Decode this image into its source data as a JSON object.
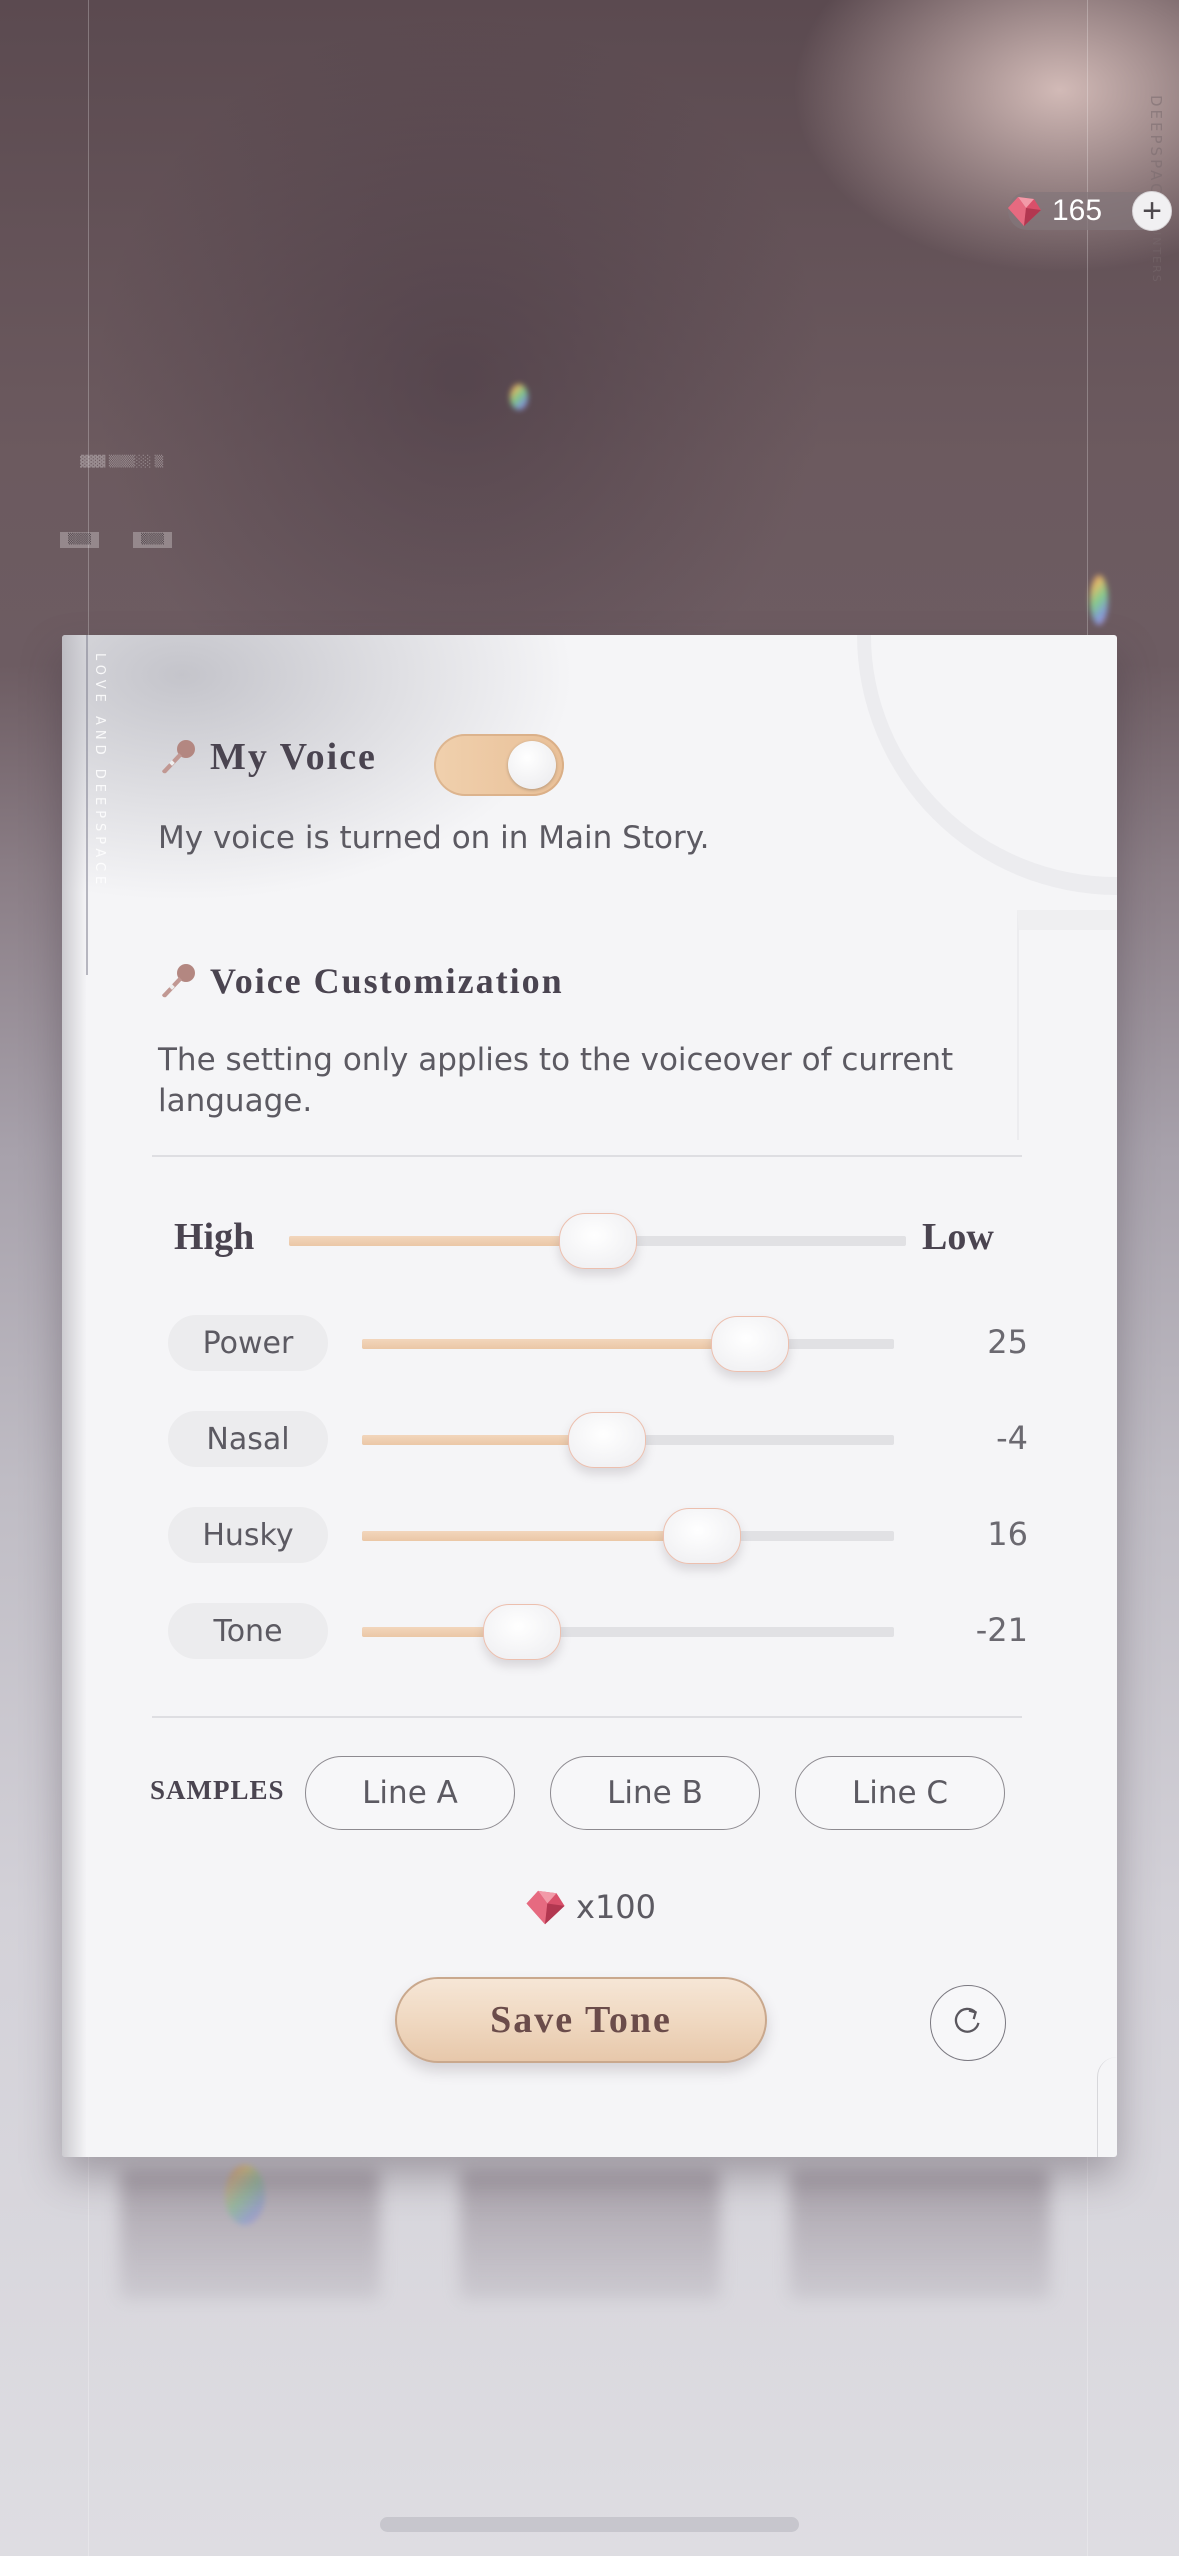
{
  "background": {
    "brand_vertical": "DEEPSPACE",
    "brand_vertical_sub": "HUNTERS"
  },
  "currency": {
    "icon": "gem-icon",
    "amount": "165",
    "add_icon": "plus-icon"
  },
  "panel": {
    "side_text": "LOVE AND DEEPSPACE",
    "my_voice": {
      "title": "My Voice",
      "icon": "microphone-icon",
      "toggle_on": true,
      "description": "My voice is turned on in Main Story."
    },
    "customization": {
      "title": "Voice Customization",
      "icon": "microphone-icon",
      "description": "The setting only applies to the voiceover of current language."
    },
    "pitch": {
      "left_label": "High",
      "right_label": "Low",
      "position_fraction": 0.5
    },
    "parameters": [
      {
        "label": "Power",
        "value": "25",
        "position_fraction": 0.73
      },
      {
        "label": "Nasal",
        "value": "-4",
        "position_fraction": 0.46
      },
      {
        "label": "Husky",
        "value": "16",
        "position_fraction": 0.64
      },
      {
        "label": "Tone",
        "value": "-21",
        "position_fraction": 0.3
      }
    ],
    "samples": {
      "label": "SAMPLES",
      "buttons": [
        "Line A",
        "Line B",
        "Line C"
      ]
    },
    "cost": {
      "icon": "gem-icon",
      "text": "x100"
    },
    "save_label": "Save Tone",
    "reset_icon": "reset-icon"
  },
  "colors": {
    "accent_fill": "#ebc7a6",
    "knob_border": "#ecbfae",
    "heading_text": "#4a4450",
    "mic_icon": "#b88c86"
  }
}
